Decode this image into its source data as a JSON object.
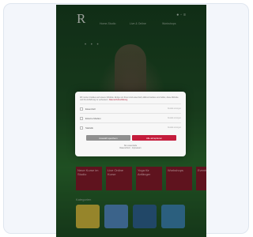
{
  "header": {
    "logo": "R",
    "nav": [
      "Home-Studio",
      "Live & Online",
      "Workshops"
    ],
    "icons": [
      "account-icon",
      "search-icon",
      "menu-icon"
    ]
  },
  "slider": {
    "dots": "• • •"
  },
  "tiles": [
    "Neue Kurse im Studio",
    "Live Online Kurse",
    "Yoga für Anfänger",
    "Workshops",
    "Events"
  ],
  "section": {
    "title": "Kategorien"
  },
  "apps": {
    "colors": [
      "#c9b23a",
      "#4f84b8",
      "#2d5f8a",
      "#3a7fa8"
    ]
  },
  "cookie": {
    "intro": "Wir nutzen Cookies auf unserer Website. Einige von ihnen sind essenziell, während andere uns helfen, diese Website und Ihre Erfahrung zu verbessern.",
    "link": "Datenschutzerklärung",
    "rows": [
      {
        "label": "Essenziell",
        "detail": "Details anzeigen"
      },
      {
        "label": "Externe Medien",
        "detail": "Details anzeigen"
      },
      {
        "label": "Statistik",
        "detail": "Details anzeigen"
      }
    ],
    "save_label": "Auswahl speichern",
    "accept_label": "Alle akzeptieren",
    "more_label": "Nur essenzielle",
    "imprint_label": "Datenschutz · Impressum"
  },
  "colors": {
    "accent": "#c41d3c",
    "secondary": "#8f8f8f",
    "background": "#1f4a27"
  }
}
